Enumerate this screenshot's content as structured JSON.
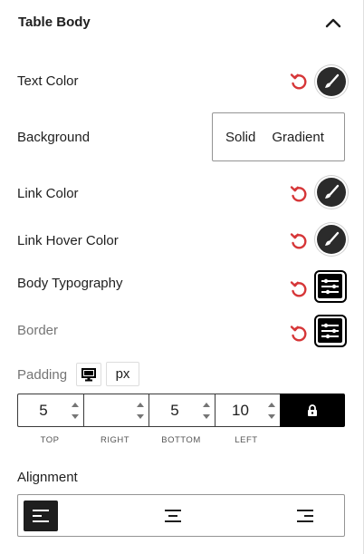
{
  "header": {
    "title": "Table Body",
    "toggle_icon": "chevron-up-icon"
  },
  "rows": {
    "text_color": {
      "label": "Text Color"
    },
    "background": {
      "label": "Background",
      "options": [
        "Solid",
        "Gradient"
      ]
    },
    "link_color": {
      "label": "Link Color"
    },
    "link_hover_color": {
      "label": "Link Hover Color"
    },
    "body_typography": {
      "label": "Body Typography"
    },
    "border": {
      "label": "Border"
    }
  },
  "padding": {
    "label": "Padding",
    "device_icon": "desktop-icon",
    "unit": "px",
    "fields": [
      {
        "side": "TOP",
        "value": "5"
      },
      {
        "side": "RIGHT",
        "value": ""
      },
      {
        "side": "BOTTOM",
        "value": "5"
      },
      {
        "side": "LEFT",
        "value": "10"
      }
    ],
    "link_icon": "lock-icon"
  },
  "alignment": {
    "label": "Alignment",
    "options": [
      "left",
      "center",
      "right"
    ],
    "selected": "left"
  },
  "colors": {
    "reset": "#d63638",
    "swatch": "#2b2b2b",
    "active": "#1e1e1e"
  }
}
